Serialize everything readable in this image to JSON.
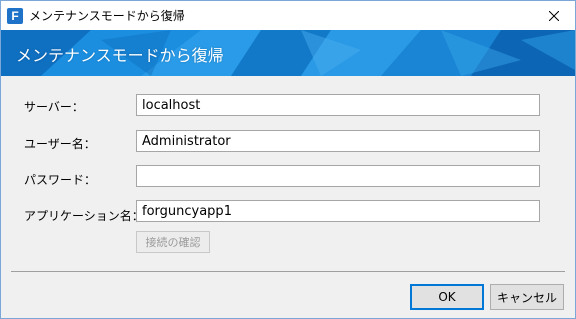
{
  "window": {
    "title": "メンテナンスモードから復帰",
    "app_icon_letter": "F",
    "close_icon": "close-icon"
  },
  "banner": {
    "title": "メンテナンスモードから復帰",
    "color": "#1a86d6"
  },
  "form": {
    "server_label": "サーバー：",
    "server_value": "localhost",
    "user_label": "ユーザー名：",
    "user_value": "Administrator",
    "password_label": "パスワード：",
    "password_value": "",
    "app_label": "アプリケーション名：",
    "app_value": "forguncyapp1",
    "check_button": "接続の確認"
  },
  "footer": {
    "ok_label": "OK",
    "cancel_label": "キャンセル",
    "accent": "#0078d7"
  }
}
